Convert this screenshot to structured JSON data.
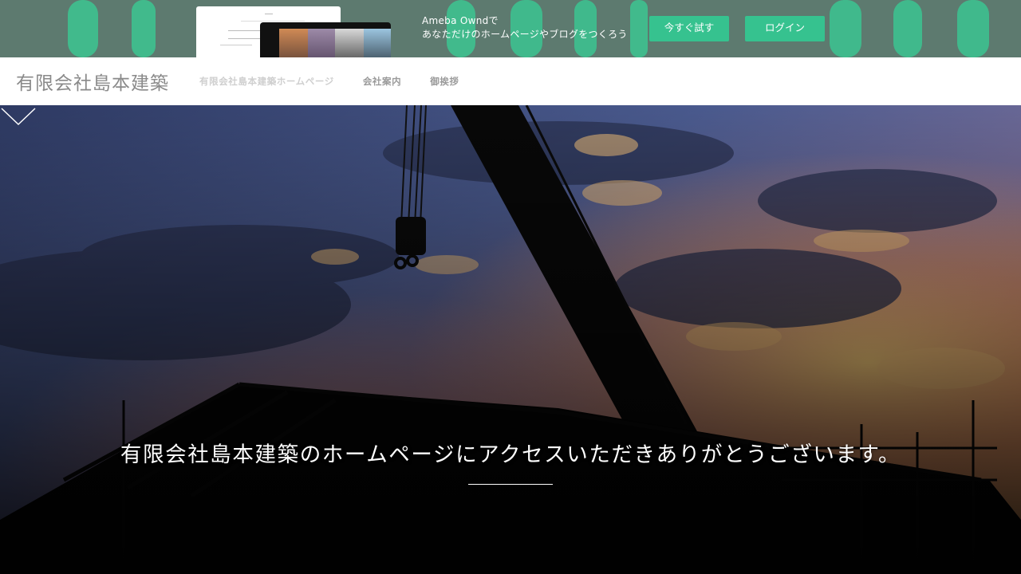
{
  "promo": {
    "line1": "Ameba Owndで",
    "line2": "あなただけのホームページやブログをつくろう",
    "try_label": "今すぐ試す",
    "login_label": "ログイン",
    "accent": "#36c28f"
  },
  "header": {
    "site_title": "有限会社島本建築",
    "nav": [
      {
        "label": "有限会社島本建築ホームページ"
      },
      {
        "label": "会社案内"
      },
      {
        "label": "御挨拶"
      }
    ]
  },
  "hero": {
    "message": "有限会社島本建築のホームページにアクセスいただきありがとうございます。",
    "scroll_icon": "chevron-down-icon"
  }
}
